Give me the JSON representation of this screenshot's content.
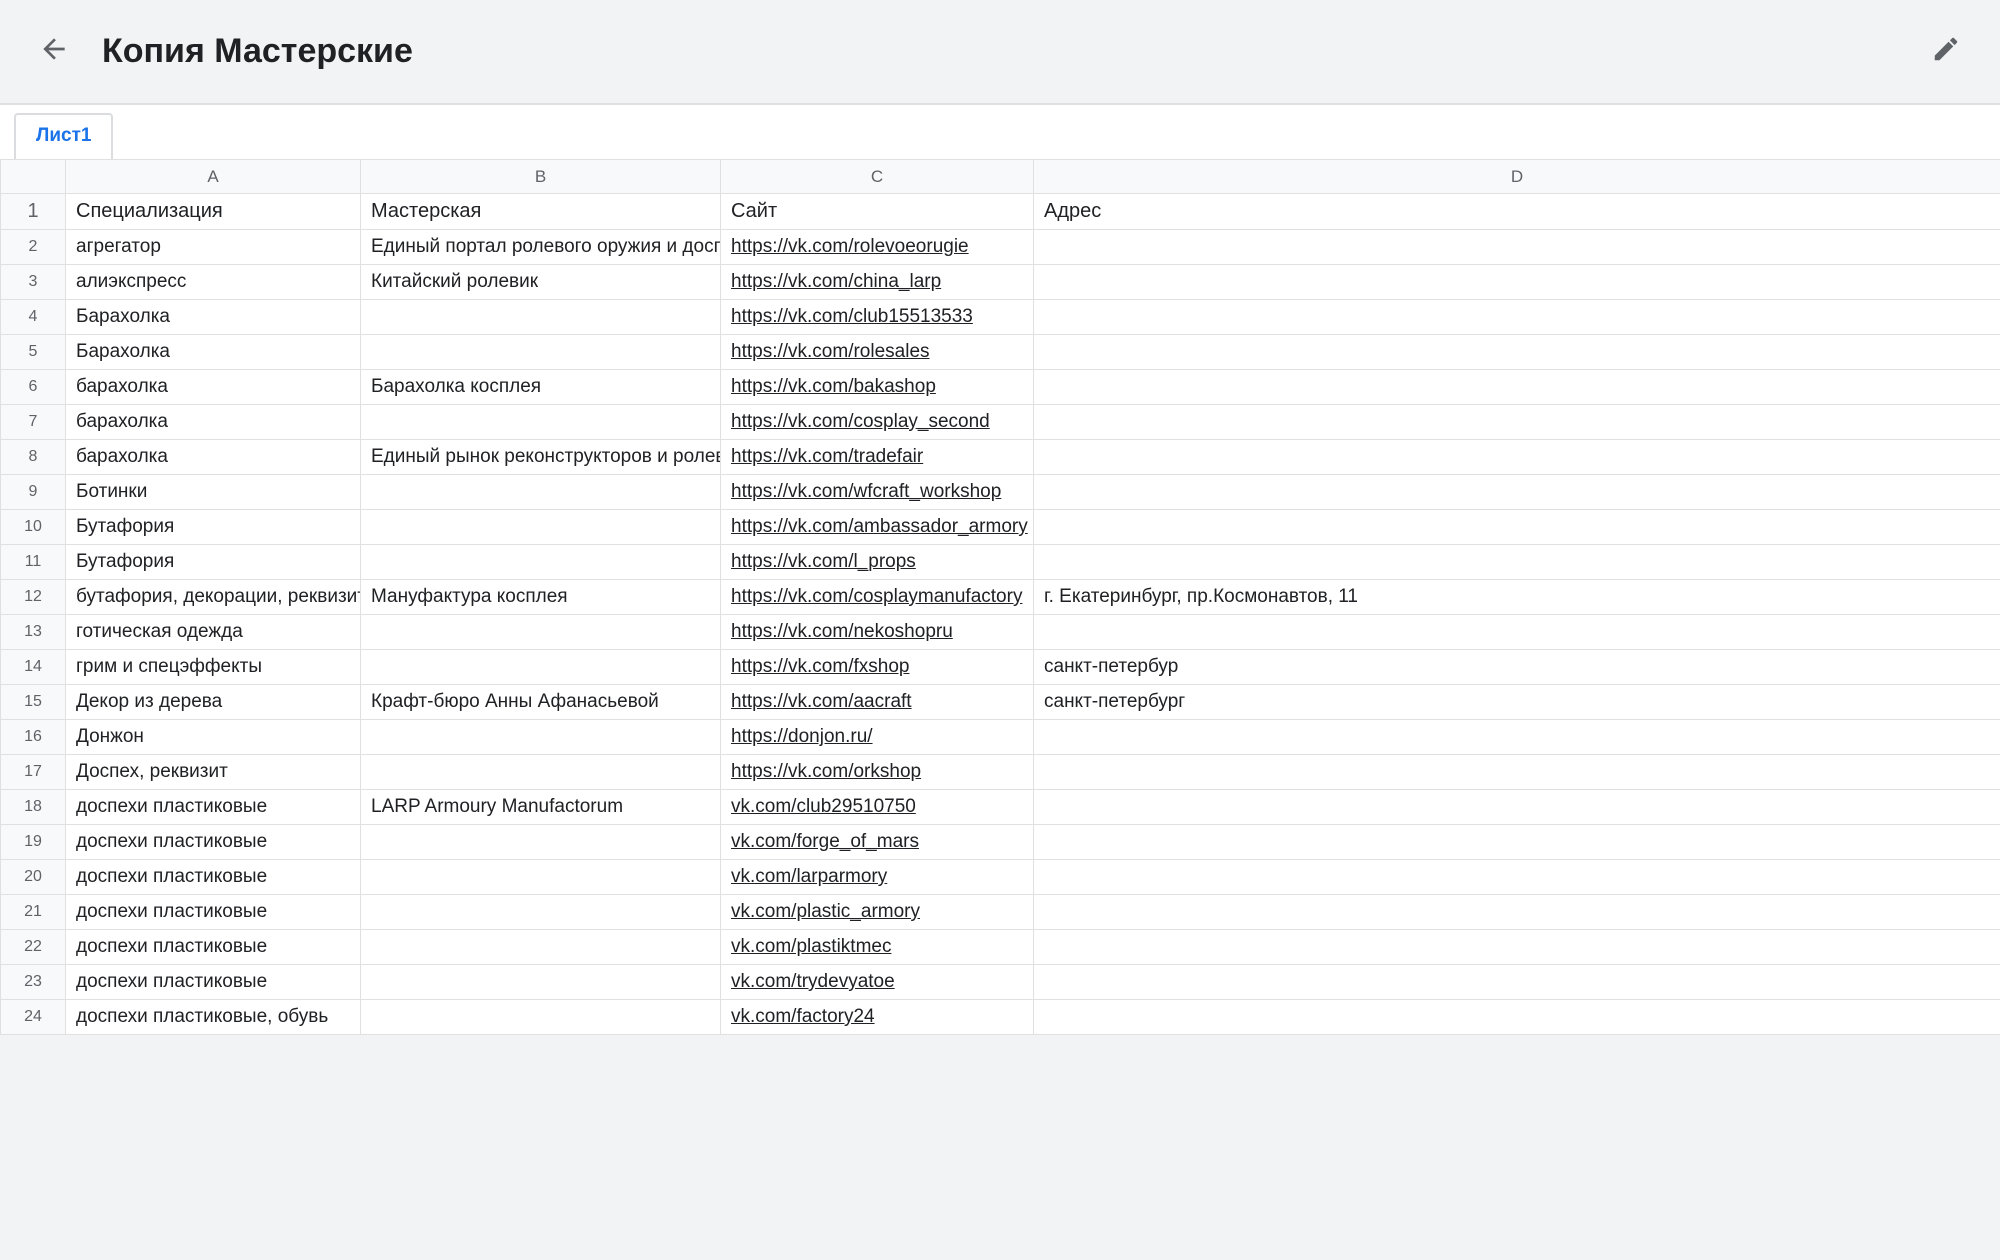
{
  "header": {
    "title": "Копия Мастерские"
  },
  "tab": {
    "label": "Лист1"
  },
  "columns": [
    "A",
    "B",
    "C",
    "D"
  ],
  "headerRow": [
    "Специализация",
    "Мастерская",
    "Сайт",
    "Адрес"
  ],
  "rows": [
    {
      "n": 2,
      "a": "агрегатор",
      "b": "Единый портал ролевого оружия и доспех",
      "c": "https://vk.com/rolevoeorugie",
      "d": ""
    },
    {
      "n": 3,
      "a": "алиэкспресс",
      "b": "Китайский ролевик",
      "c": "https://vk.com/china_larp",
      "d": ""
    },
    {
      "n": 4,
      "a": "Барахолка",
      "b": "",
      "c": "https://vk.com/club15513533",
      "d": ""
    },
    {
      "n": 5,
      "a": "Барахолка",
      "b": "",
      "c": "https://vk.com/rolesales",
      "d": ""
    },
    {
      "n": 6,
      "a": "барахолка",
      "b": "Барахолка косплея",
      "c": "https://vk.com/bakashop",
      "d": ""
    },
    {
      "n": 7,
      "a": "барахолка",
      "b": "",
      "c": "https://vk.com/cosplay_second",
      "d": ""
    },
    {
      "n": 8,
      "a": "барахолка",
      "b": "Единый рынок реконструкторов и ролеви",
      "c": "https://vk.com/tradefair",
      "d": ""
    },
    {
      "n": 9,
      "a": "Ботинки",
      "b": "",
      "c": "https://vk.com/wfcraft_workshop",
      "d": ""
    },
    {
      "n": 10,
      "a": "Бутафория",
      "b": "",
      "c": "https://vk.com/ambassador_armory",
      "d": ""
    },
    {
      "n": 11,
      "a": "Бутафория",
      "b": "",
      "c": "https://vk.com/l_props",
      "d": ""
    },
    {
      "n": 12,
      "a": "бутафория, декорации, реквизит",
      "b": "Мануфактура косплея",
      "c": "https://vk.com/cosplaymanufactory",
      "d": "г. Екатеринбург, пр.Космонавтов, 11"
    },
    {
      "n": 13,
      "a": "готическая одежда",
      "b": "",
      "c": "https://vk.com/nekoshopru",
      "d": ""
    },
    {
      "n": 14,
      "a": "грим и спецэффекты",
      "b": "",
      "c": "https://vk.com/fxshop",
      "d": "санкт-петербур"
    },
    {
      "n": 15,
      "a": "Декор из дерева",
      "b": "Крафт-бюро Анны Афанасьевой",
      "c": "https://vk.com/aacraft",
      "d": "санкт-петербург"
    },
    {
      "n": 16,
      "a": "Донжон",
      "b": "",
      "c": "https://donjon.ru/",
      "d": ""
    },
    {
      "n": 17,
      "a": "Доспех, реквизит",
      "b": "",
      "c": "https://vk.com/orkshop",
      "d": ""
    },
    {
      "n": 18,
      "a": "доспехи пластиковые",
      "b": "LARP Armoury Manufactorum",
      "c": "vk.com/club29510750",
      "d": ""
    },
    {
      "n": 19,
      "a": "доспехи пластиковые",
      "b": "",
      "c": "vk.com/forge_of_mars",
      "d": ""
    },
    {
      "n": 20,
      "a": "доспехи пластиковые",
      "b": "",
      "c": "vk.com/larparmory",
      "d": ""
    },
    {
      "n": 21,
      "a": "доспехи пластиковые",
      "b": "",
      "c": "vk.com/plastic_armory",
      "d": ""
    },
    {
      "n": 22,
      "a": "доспехи пластиковые",
      "b": "",
      "c": "vk.com/plastiktmec",
      "d": ""
    },
    {
      "n": 23,
      "a": "доспехи пластиковые",
      "b": "",
      "c": "vk.com/trydevyatoe",
      "d": ""
    },
    {
      "n": 24,
      "a": "доспехи пластиковые, обувь",
      "b": "",
      "c": "vk.com/factory24",
      "d": ""
    }
  ]
}
